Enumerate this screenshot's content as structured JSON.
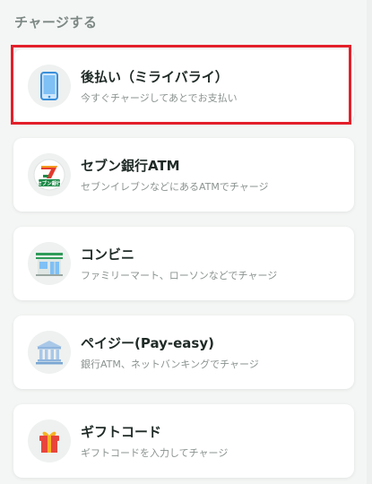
{
  "section": {
    "title": "チャージする"
  },
  "methods": [
    {
      "title": "後払い（ミライバライ）",
      "description": "今すぐチャージしてあとでお支払い",
      "icon": "smartphone-icon",
      "selected": true
    },
    {
      "title": "セブン銀行ATM",
      "description": "セブンイレブンなどにあるATMでチャージ",
      "icon": "seven-bank-logo-icon",
      "icon_text": "セブン銀行"
    },
    {
      "title": "コンビニ",
      "description": "ファミリーマート、ローソンなどでチャージ",
      "icon": "convenience-store-icon"
    },
    {
      "title": "ペイジー(Pay-easy)",
      "description": "銀行ATM、ネットバンキングでチャージ",
      "icon": "bank-icon"
    },
    {
      "title": "ギフトコード",
      "description": "ギフトコードを入力してチャージ",
      "icon": "gift-icon"
    }
  ],
  "colors": {
    "highlight": "#e3202a",
    "background": "#f4f6f5",
    "card": "#ffffff"
  }
}
